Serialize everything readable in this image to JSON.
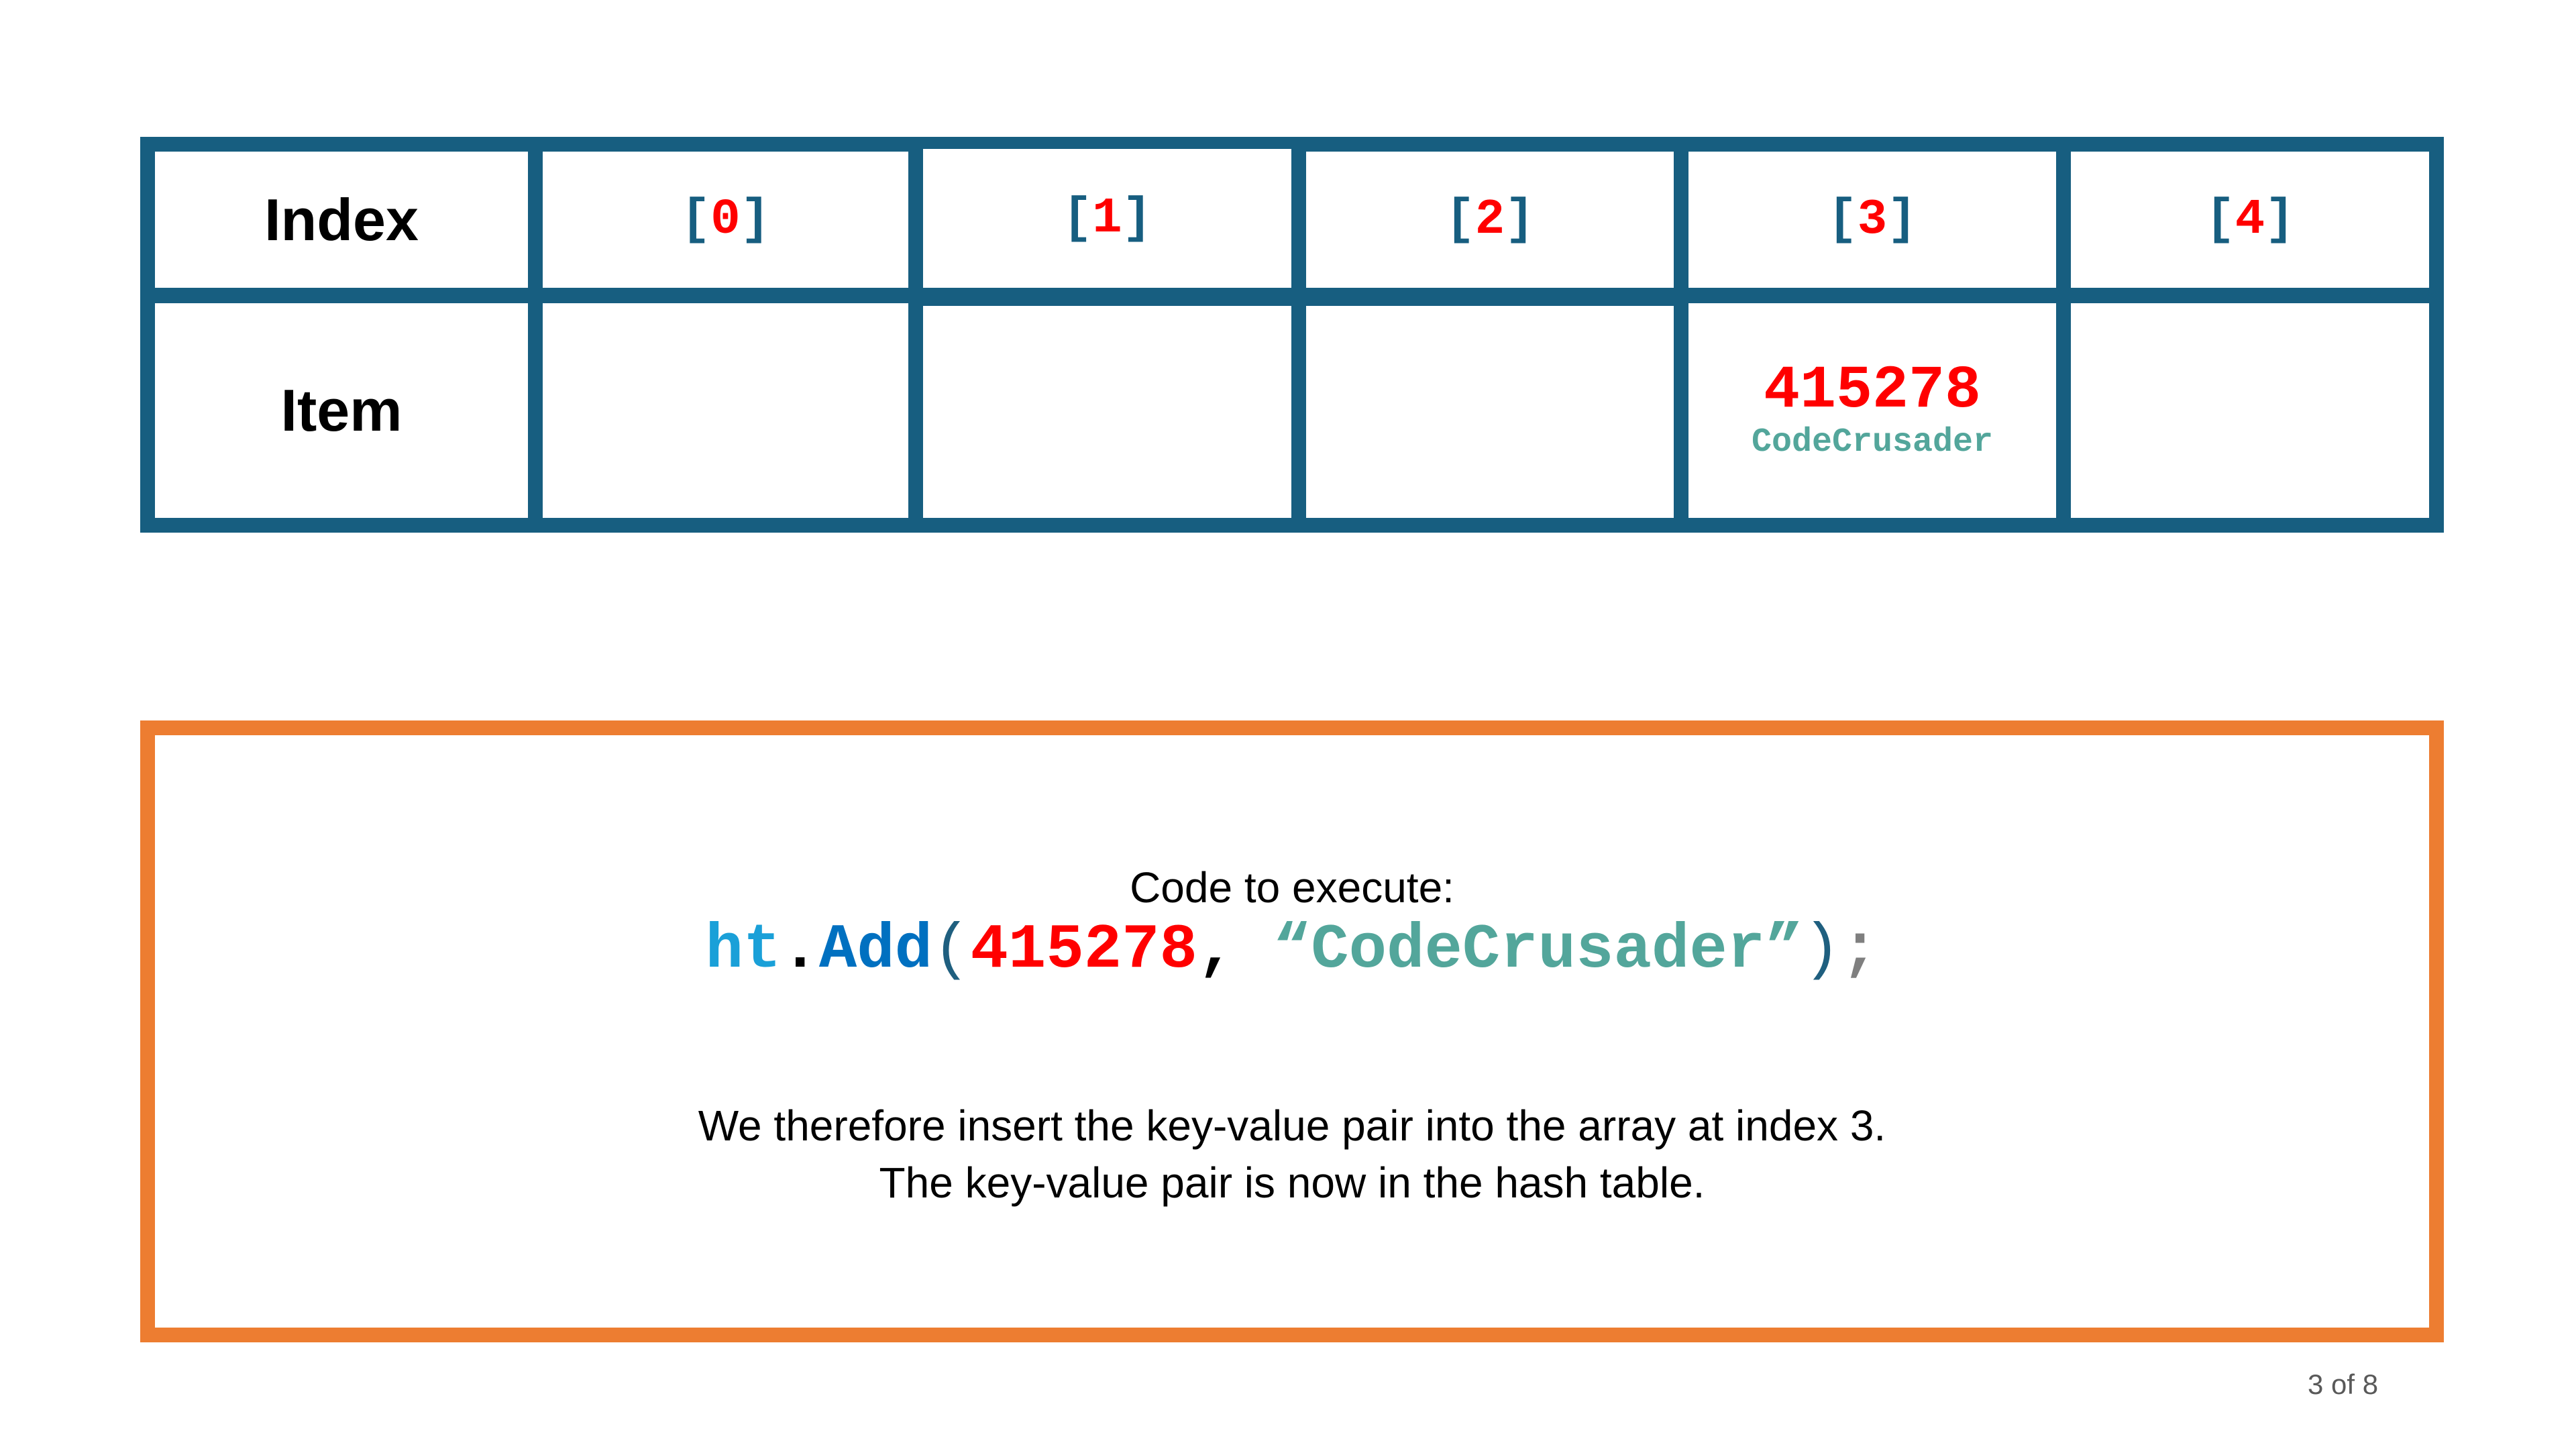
{
  "table": {
    "row_headers": [
      "Index",
      "Item"
    ],
    "indices": [
      {
        "open": "[",
        "num": "0",
        "close": "]"
      },
      {
        "open": "[",
        "num": "1",
        "close": "]"
      },
      {
        "open": "[",
        "num": "2",
        "close": "]"
      },
      {
        "open": "[",
        "num": "3",
        "close": "]"
      },
      {
        "open": "[",
        "num": "4",
        "close": "]"
      }
    ],
    "items": [
      null,
      null,
      null,
      {
        "key": "415278",
        "value": "CodeCrusader"
      },
      null
    ]
  },
  "panel": {
    "intro": "Code to execute:",
    "code": {
      "obj": "ht",
      "dot": ".",
      "method": "Add",
      "open_paren": "(",
      "key": "415278",
      "comma": ", ",
      "value": "“CodeCrusader”",
      "close_paren": ")",
      "semicolon": ";"
    },
    "line1": "We therefore insert the key-value pair into the array at index 3.",
    "line2": "The key-value pair is now in the hash table."
  },
  "pager": "3 of 8",
  "colors": {
    "grid": "#175E80",
    "frame": "#ED7D31",
    "red": "#FF0000",
    "teal": "#53A69B",
    "obj": "#1AA0D8",
    "method": "#0070C0"
  }
}
